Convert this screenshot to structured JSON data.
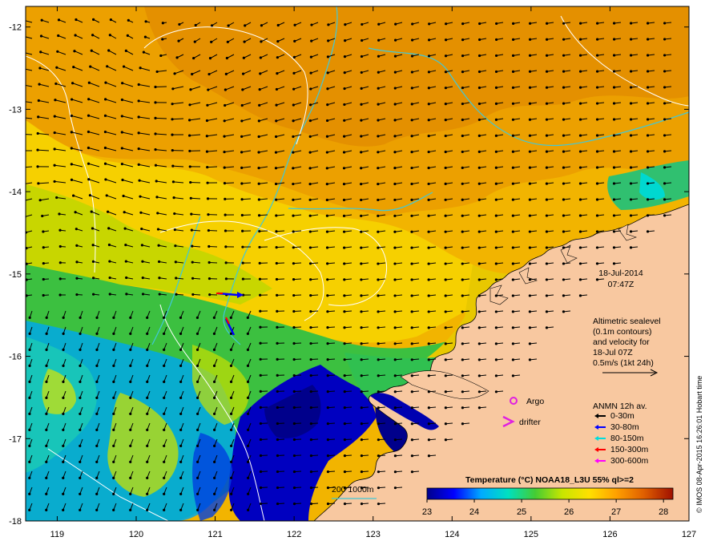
{
  "chart_data": {
    "type": "heatmap",
    "title": "Temperature (°C) NOAA18_L3U 55% ql>=2",
    "x_ticks": [
      "119",
      "120",
      "121",
      "122",
      "123",
      "124",
      "125",
      "126",
      "127"
    ],
    "y_ticks": [
      "-12",
      "-13",
      "-14",
      "-15",
      "-16",
      "-17",
      "-18"
    ],
    "xlim": [
      118.6,
      127.0
    ],
    "ylim": [
      -18.0,
      -11.75
    ],
    "colorbar": {
      "ticks": [
        "23",
        "24",
        "25",
        "26",
        "27",
        "28"
      ],
      "range": [
        23,
        28.2
      ],
      "colors": [
        "#00008b",
        "#0000ff",
        "#00aaff",
        "#00e0c0",
        "#44cc33",
        "#c8e600",
        "#ffe000",
        "#ffa000",
        "#e06000",
        "#a01000"
      ]
    }
  },
  "panel": {
    "date": "18-Jul-2014",
    "time": "07:47Z",
    "altimetry_lines": [
      "Altimetric sealevel",
      "(0.1m contours)",
      "and velocity for",
      "18-Jul 07Z",
      "0.5m/s (1kt 24h)"
    ],
    "argo_label": "Argo",
    "drifter_label": "drifter",
    "anmn_title": "ANMN 12h av.",
    "anmn_legend": [
      {
        "label": "0-30m",
        "color": "#000000"
      },
      {
        "label": "30-80m",
        "color": "#0000ff"
      },
      {
        "label": "80-150m",
        "color": "#00dddd"
      },
      {
        "label": "150-300m",
        "color": "#ff0000"
      },
      {
        "label": "300-600m",
        "color": "#ff00ff"
      }
    ],
    "isobath_label": "200  1000m"
  },
  "credit": "© IMOS 08-Apr-2015 16:26:01 Hobart time",
  "colors": {
    "land": "#f8c8a0",
    "contour": "#ffffff",
    "isobath": "#40c8d8",
    "argo": "#e020e0",
    "drifter": "#e020e0"
  }
}
